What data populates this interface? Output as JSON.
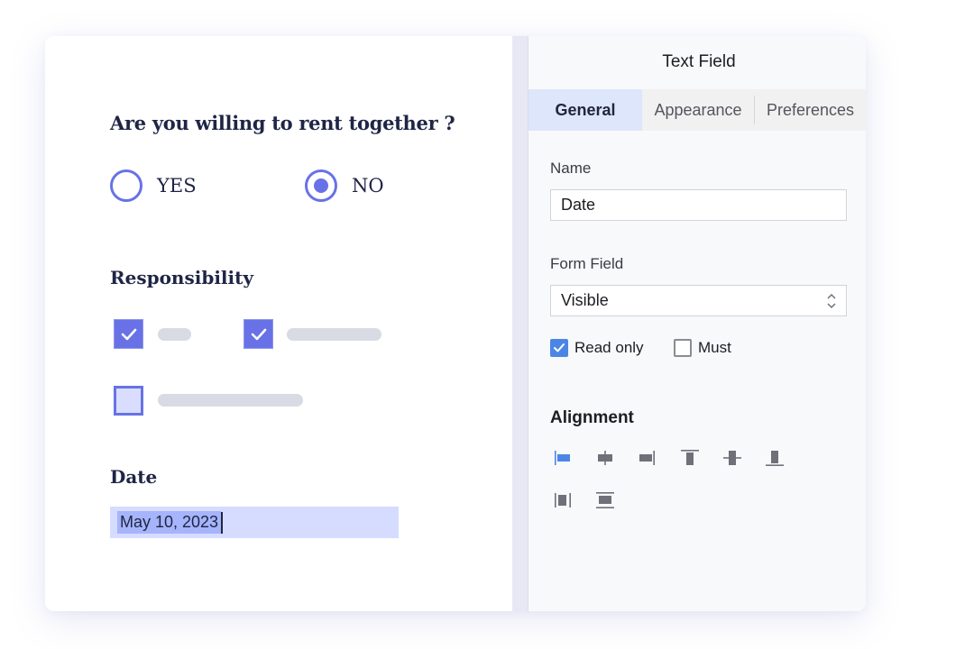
{
  "form": {
    "question": "Are you willing to rent together ?",
    "options": [
      {
        "label": "YES",
        "selected": false
      },
      {
        "label": "NO",
        "selected": true
      }
    ],
    "responsibility": {
      "title": "Responsibility",
      "items": [
        {
          "checked": true
        },
        {
          "checked": true
        },
        {
          "checked": false
        }
      ]
    },
    "date": {
      "label": "Date",
      "value": "May 10, 2023"
    }
  },
  "panel": {
    "title": "Text Field",
    "tabs": [
      {
        "label": "General",
        "active": true
      },
      {
        "label": "Appearance",
        "active": false
      },
      {
        "label": "Preferences",
        "active": false
      }
    ],
    "name_label": "Name",
    "name_value": "Date",
    "form_field_label": "Form Field",
    "form_field_value": "Visible",
    "read_only_label": "Read only",
    "read_only_checked": true,
    "must_label": "Must",
    "must_checked": false,
    "alignment_title": "Alignment",
    "alignment_icons": [
      {
        "name": "align-left-icon",
        "active": true
      },
      {
        "name": "align-center-horizontal-icon",
        "active": false
      },
      {
        "name": "align-right-icon",
        "active": false
      },
      {
        "name": "align-top-icon",
        "active": false
      },
      {
        "name": "align-center-vertical-icon",
        "active": false
      },
      {
        "name": "align-bottom-icon",
        "active": false
      },
      {
        "name": "distribute-horizontal-icon",
        "active": false
      },
      {
        "name": "distribute-vertical-icon",
        "active": false
      }
    ]
  },
  "colors": {
    "accent": "#6872e6",
    "selection": "#a6b4fb",
    "input_bg": "#d5dcff",
    "tab_active_bg": "#dde6fb",
    "checkbox_blue": "#4b86e6",
    "icon_gray": "#6f7079"
  }
}
